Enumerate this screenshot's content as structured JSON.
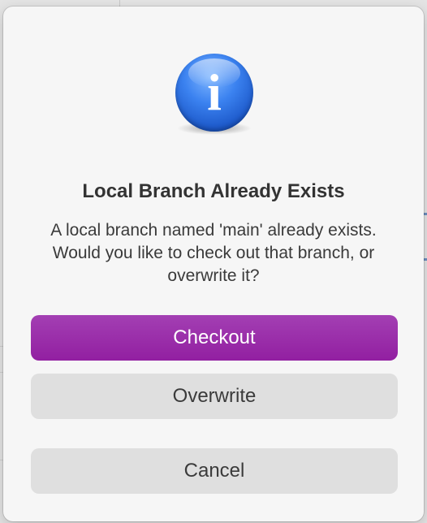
{
  "dialog": {
    "icon": "info-icon",
    "icon_glyph": "i",
    "title": "Local Branch Already Exists",
    "message": "A local branch named 'main' already exists. Would you like to check out that branch, or overwrite it?",
    "buttons": {
      "primary_label": "Checkout",
      "overwrite_label": "Overwrite",
      "cancel_label": "Cancel"
    }
  },
  "colors": {
    "primary_button": "#9b2eab",
    "secondary_button": "#dfdfdf",
    "dialog_background": "#f6f6f6",
    "icon_blue": "#2f74e6"
  }
}
